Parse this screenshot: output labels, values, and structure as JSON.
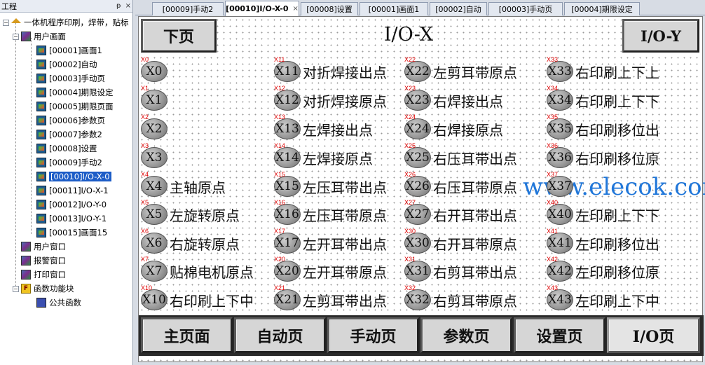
{
  "tree": {
    "header": "工程",
    "pin": "ᵽ",
    "close": "×",
    "root": "一体机程序印刷，焊带，贴标",
    "user_screens": "用户画面",
    "pages": [
      "[00001]画面1",
      "[00002]自动",
      "[00003]手动页",
      "[00004]期限设定",
      "[00005]期限页面",
      "[00006]参数页",
      "[00007]参数2",
      "[00008]设置",
      "[00009]手动2",
      "[00010]I/O-X-0",
      "[00011]I/O-X-1",
      "[00012]I/O-Y-0",
      "[00013]I/O-Y-1",
      "[00015]画面15"
    ],
    "selected_index": 9,
    "user_window": "用户窗口",
    "alarm_window": "报警窗口",
    "print_window": "打印窗口",
    "function_blocks": "函数功能块",
    "public_functions": "公共函数"
  },
  "tabs": [
    {
      "label": "[00009]手动2"
    },
    {
      "label": "[00010]I/O-X-0",
      "active": true,
      "close": "×"
    },
    {
      "label": "[00008]设置"
    },
    {
      "label": "[00001]画面1"
    },
    {
      "label": "[00002]自动"
    },
    {
      "label": "[00003]手动页"
    },
    {
      "label": "[00004]期限设定"
    }
  ],
  "screen": {
    "title": "I/O-X",
    "prev_button": "下页",
    "next_button": "I/O-Y",
    "watermark": "www.elecok.com",
    "io_columns": [
      [
        {
          "tag": "X0",
          "id": "X0",
          "label": ""
        },
        {
          "tag": "X1",
          "id": "X1",
          "label": ""
        },
        {
          "tag": "X2",
          "id": "X2",
          "label": ""
        },
        {
          "tag": "X3",
          "id": "X3",
          "label": ""
        },
        {
          "tag": "X4",
          "id": "X4",
          "label": "主轴原点"
        },
        {
          "tag": "X5",
          "id": "X5",
          "label": "左旋转原点"
        },
        {
          "tag": "X6",
          "id": "X6",
          "label": "右旋转原点"
        },
        {
          "tag": "X7",
          "id": "X7",
          "label": "贴棉电机原点"
        },
        {
          "tag": "X10",
          "id": "X10",
          "label": "右印刷上下中"
        }
      ],
      [
        {
          "tag": "X11",
          "id": "X11",
          "label": "对折焊接出点"
        },
        {
          "tag": "X12",
          "id": "X12",
          "label": "对折焊接原点"
        },
        {
          "tag": "X13",
          "id": "X13",
          "label": "左焊接出点"
        },
        {
          "tag": "X14",
          "id": "X14",
          "label": "左焊接原点"
        },
        {
          "tag": "X15",
          "id": "X15",
          "label": "左压耳带出点"
        },
        {
          "tag": "X16",
          "id": "X16",
          "label": "左压耳带原点"
        },
        {
          "tag": "X17",
          "id": "X17",
          "label": "左开耳带出点"
        },
        {
          "tag": "X20",
          "id": "X20",
          "label": "左开耳带原点"
        },
        {
          "tag": "X21",
          "id": "X21",
          "label": "左剪耳带出点"
        }
      ],
      [
        {
          "tag": "X22",
          "id": "X22",
          "label": "左剪耳带原点"
        },
        {
          "tag": "X23",
          "id": "X23",
          "label": "右焊接出点"
        },
        {
          "tag": "X24",
          "id": "X24",
          "label": "右焊接原点"
        },
        {
          "tag": "X25",
          "id": "X25",
          "label": "右压耳带出点"
        },
        {
          "tag": "X26",
          "id": "X26",
          "label": "右压耳带原点"
        },
        {
          "tag": "X27",
          "id": "X27",
          "label": "右开耳带出点"
        },
        {
          "tag": "X30",
          "id": "X30",
          "label": "右开耳带原点"
        },
        {
          "tag": "X31",
          "id": "X31",
          "label": "右剪耳带出点"
        },
        {
          "tag": "X32",
          "id": "X32",
          "label": "右剪耳带原点"
        }
      ],
      [
        {
          "tag": "X33",
          "id": "X33",
          "label": "右印刷上下上"
        },
        {
          "tag": "X34",
          "id": "X34",
          "label": "右印刷上下下"
        },
        {
          "tag": "X35",
          "id": "X35",
          "label": "右印刷移位出"
        },
        {
          "tag": "X36",
          "id": "X36",
          "label": "右印刷移位原"
        },
        {
          "tag": "X37",
          "id": "X37",
          "label": ""
        },
        {
          "tag": "X40",
          "id": "X40",
          "label": "左印刷上下下"
        },
        {
          "tag": "X41",
          "id": "X41",
          "label": "左印刷移位出"
        },
        {
          "tag": "X42",
          "id": "X42",
          "label": "左印刷移位原"
        },
        {
          "tag": "X43",
          "id": "X43",
          "label": "左印刷上下中"
        }
      ]
    ],
    "nav_buttons": [
      "主页面",
      "自动页",
      "手动页",
      "参数页",
      "设置页",
      "I/O页"
    ]
  }
}
